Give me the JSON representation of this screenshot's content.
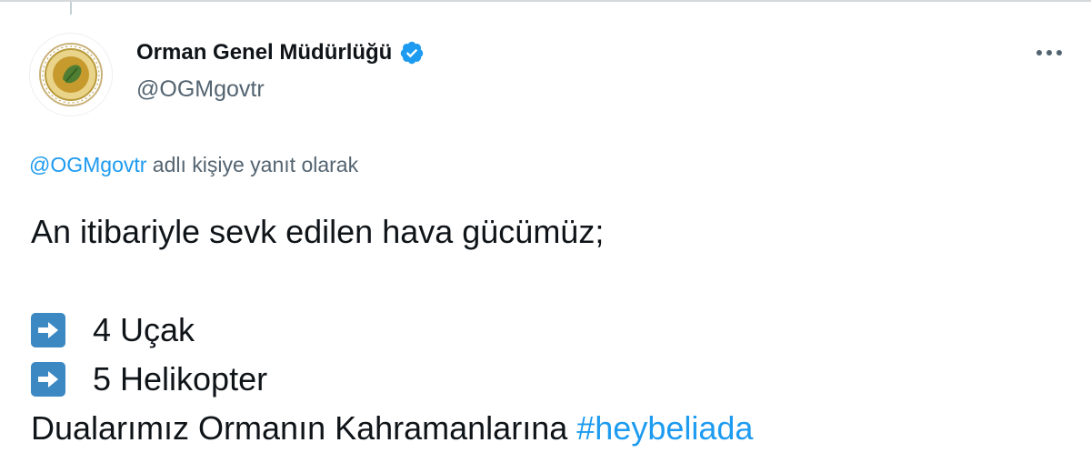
{
  "author": {
    "display_name": "Orman Genel Müdürlüğü",
    "handle": "@OGMgovtr",
    "verified": true,
    "avatar_icon": "ogm-logo-icon"
  },
  "reply_context": {
    "mention": "@OGMgovtr",
    "suffix": " adlı kişiye yanıt olarak"
  },
  "tweet": {
    "line1": "An itibariyle sevk edilen hava gücümüz;",
    "items": [
      {
        "icon": "right-arrow-emoji-icon",
        "text": "4 Uçak"
      },
      {
        "icon": "right-arrow-emoji-icon",
        "text": "5 Helikopter"
      }
    ],
    "closing_text": "Dualarımız Ormanın Kahramanlarına ",
    "hashtag": "#heybeliada"
  },
  "colors": {
    "link": "#1d9bf0",
    "text": "#0f1419",
    "secondary": "#536471",
    "emoji_blue": "#3b88c3"
  }
}
